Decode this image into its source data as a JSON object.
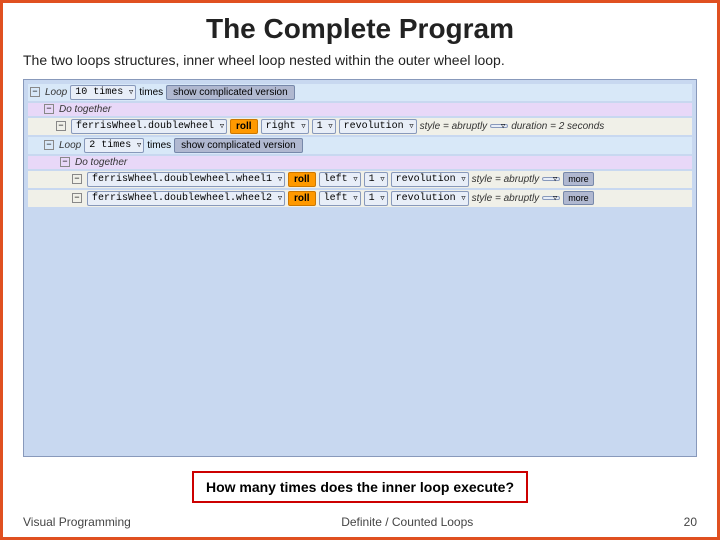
{
  "page": {
    "title": "The Complete Program",
    "subtitle": "The two loops structures, inner wheel loop nested within the outer wheel loop.",
    "footer": {
      "left": "Visual Programming",
      "center": "Definite / Counted Loops",
      "right": "20"
    }
  },
  "code": {
    "outer_loop": {
      "minus": "−",
      "loop_label": "Loop",
      "times_value": "10 times",
      "times_label": "times",
      "show_btn": "show complicated version"
    },
    "do_together_outer": {
      "minus": "−",
      "label": "Do together"
    },
    "ferris_outer": {
      "minus": "−",
      "object": "ferrisWheel.doublewheel",
      "action": "roll",
      "direction": "right",
      "count": "1",
      "unit": "revolution",
      "style_label": "style = abruptly",
      "duration_label": "duration = 2 seconds"
    },
    "inner_loop": {
      "minus": "−",
      "loop_label": "Loop",
      "times_value": "2 times",
      "times_label": "times",
      "show_btn": "show complicated version"
    },
    "do_together_inner": {
      "minus": "−",
      "label": "Do together"
    },
    "ferris_inner1": {
      "minus": "−",
      "object": "ferrisWheel.doublewheel.wheel1",
      "action": "roll",
      "direction": "left",
      "count": "1",
      "unit": "revolution",
      "style_label": "style = abruptly",
      "more": "more"
    },
    "ferris_inner2": {
      "minus": "−",
      "object": "ferrisWheel.doublewheel.wheel2",
      "action": "roll",
      "direction": "left",
      "count": "1",
      "unit": "revolution",
      "style_label": "style = abruptly",
      "more": "more"
    }
  },
  "question": "How many times does the inner loop execute?"
}
